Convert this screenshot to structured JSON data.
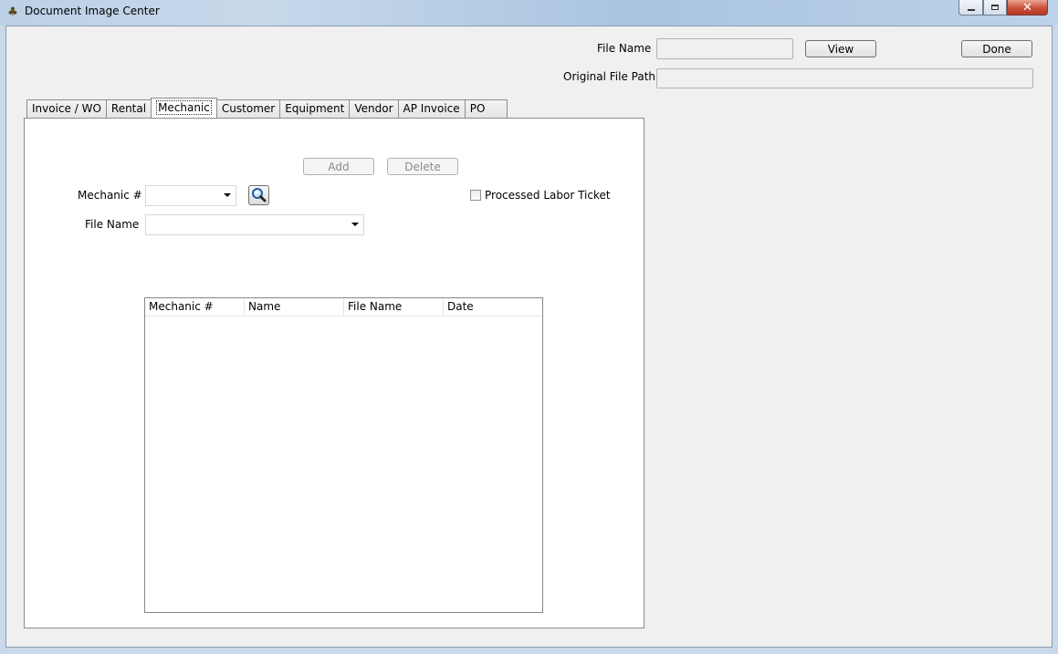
{
  "window": {
    "title": "Document Image Center",
    "icon": "app-icon",
    "controls": {
      "minimize": "minimize-icon",
      "maximize": "maximize-icon",
      "close": "close-icon"
    }
  },
  "header": {
    "file_name_label": "File Name",
    "file_name_value": "",
    "view_button": "View",
    "done_button": "Done",
    "original_path_label": "Original File Path",
    "original_path_value": ""
  },
  "tabs": [
    {
      "label": "Invoice / WO"
    },
    {
      "label": "Rental"
    },
    {
      "label": "Mechanic",
      "active": true
    },
    {
      "label": "Customer"
    },
    {
      "label": "Equipment"
    },
    {
      "label": "Vendor"
    },
    {
      "label": "AP Invoice"
    },
    {
      "label": "PO"
    }
  ],
  "mechanic_tab": {
    "add_button": "Add",
    "delete_button": "Delete",
    "mechanic_label": "Mechanic #",
    "mechanic_value": "",
    "lookup_icon": "search-icon",
    "processed_label": "Processed Labor Ticket",
    "processed_checked": false,
    "file_name_label": "File Name",
    "file_name_value": "",
    "grid": {
      "columns": [
        "Mechanic #",
        "Name",
        "File Name",
        "Date"
      ],
      "rows": []
    }
  }
}
